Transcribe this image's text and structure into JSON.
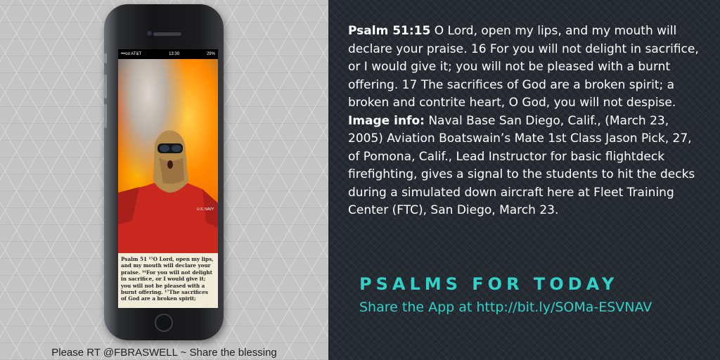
{
  "phone": {
    "carrier": "•••oo AT&T",
    "time": "13:30",
    "battery": "29%",
    "caption_text": "Psalm 51 ¹⁵O Lord, open my lips, and my mouth will declare your praise. ¹⁶For you will not delight in sacrifice, or I would give it; you will not be pleased with a burnt offering. ¹⁷The sacrifices of God are a broken spirit;",
    "uniform_text": "U.S. NAVY"
  },
  "footer": {
    "left_text": "Please RT @FBRASWELL ~ Share the blessing"
  },
  "verse": {
    "ref_label": "Psalm 51:15",
    "text": " O Lord, open my lips, and my mouth will declare your praise. 16 For you will not delight in sacrifice, or I would give it; you will not be pleased with a burnt offering. 17 The sacrifices of God are a broken spirit; a broken and contrite heart, O God, you will not despise."
  },
  "image_info": {
    "label": "Image info:",
    "text": " Naval Base San Diego, Calif., (March 23, 2005) Aviation Boatswain’s Mate 1st Class Jason Pick, 27, of Pomona, Calif., Lead Instructor for basic flightdeck firefighting, gives a signal to the students to hit the decks during a simulated down aircraft here at Fleet Training Center (FTC), San Diego, March 23."
  },
  "branding": {
    "title": "PSALMS FOR TODAY",
    "share_text": "Share the App at  http://bit.ly/SOMa-ESVNAV"
  },
  "colors": {
    "accent": "#2fd1c8",
    "right_bg": "#262b33",
    "left_bg": "#c4c4c4"
  }
}
